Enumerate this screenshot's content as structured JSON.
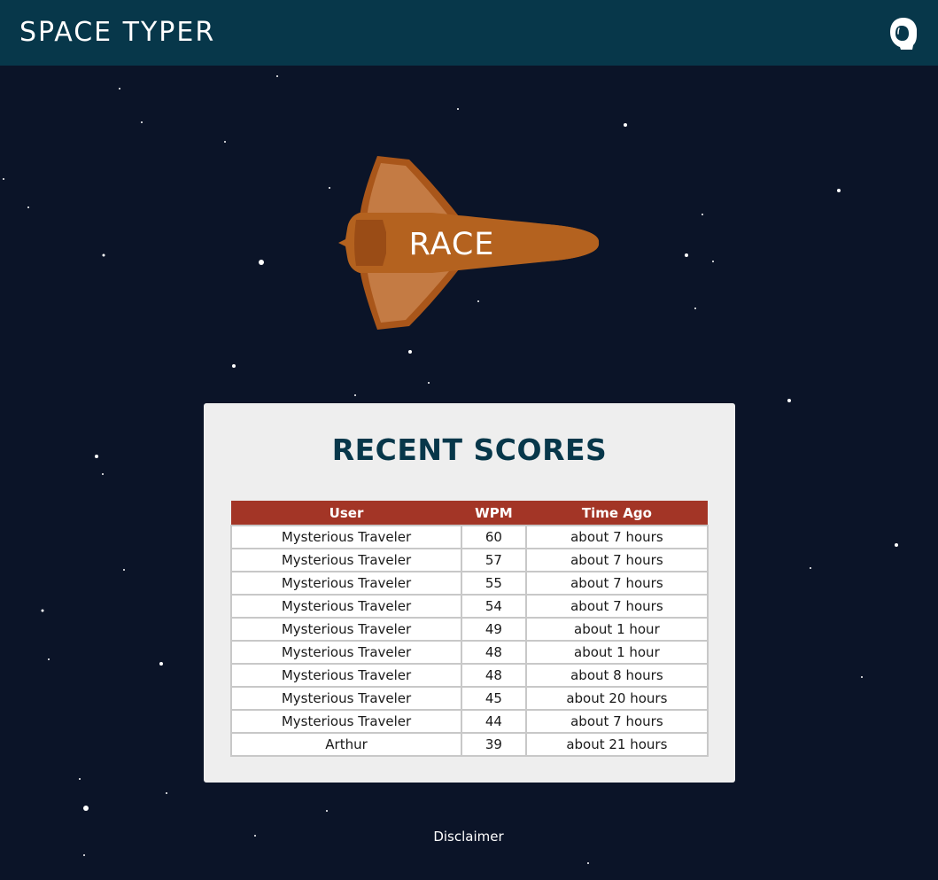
{
  "header": {
    "title": "SPACE TYPER",
    "profile_icon": "astronaut-helmet-icon"
  },
  "hero": {
    "race_label": "RACE",
    "ship_icon": "space-shuttle-icon"
  },
  "scores_panel": {
    "title": "RECENT SCORES",
    "columns": [
      "User",
      "WPM",
      "Time Ago"
    ],
    "rows": [
      {
        "user": "Mysterious Traveler",
        "wpm": "60",
        "time_ago": "about 7 hours"
      },
      {
        "user": "Mysterious Traveler",
        "wpm": "57",
        "time_ago": "about 7 hours"
      },
      {
        "user": "Mysterious Traveler",
        "wpm": "55",
        "time_ago": "about 7 hours"
      },
      {
        "user": "Mysterious Traveler",
        "wpm": "54",
        "time_ago": "about 7 hours"
      },
      {
        "user": "Mysterious Traveler",
        "wpm": "49",
        "time_ago": "about 1 hour"
      },
      {
        "user": "Mysterious Traveler",
        "wpm": "48",
        "time_ago": "about 1 hour"
      },
      {
        "user": "Mysterious Traveler",
        "wpm": "48",
        "time_ago": "about 8 hours"
      },
      {
        "user": "Mysterious Traveler",
        "wpm": "45",
        "time_ago": "about 20 hours"
      },
      {
        "user": "Mysterious Traveler",
        "wpm": "44",
        "time_ago": "about 7 hours"
      },
      {
        "user": "Arthur",
        "wpm": "39",
        "time_ago": "about 21 hours"
      }
    ]
  },
  "footer": {
    "disclaimer": "Disclaimer"
  },
  "colors": {
    "background": "#0b1428",
    "header": "#07374a",
    "ship": "#b4621f",
    "table_header": "#a33526",
    "panel": "#eeeeee"
  }
}
